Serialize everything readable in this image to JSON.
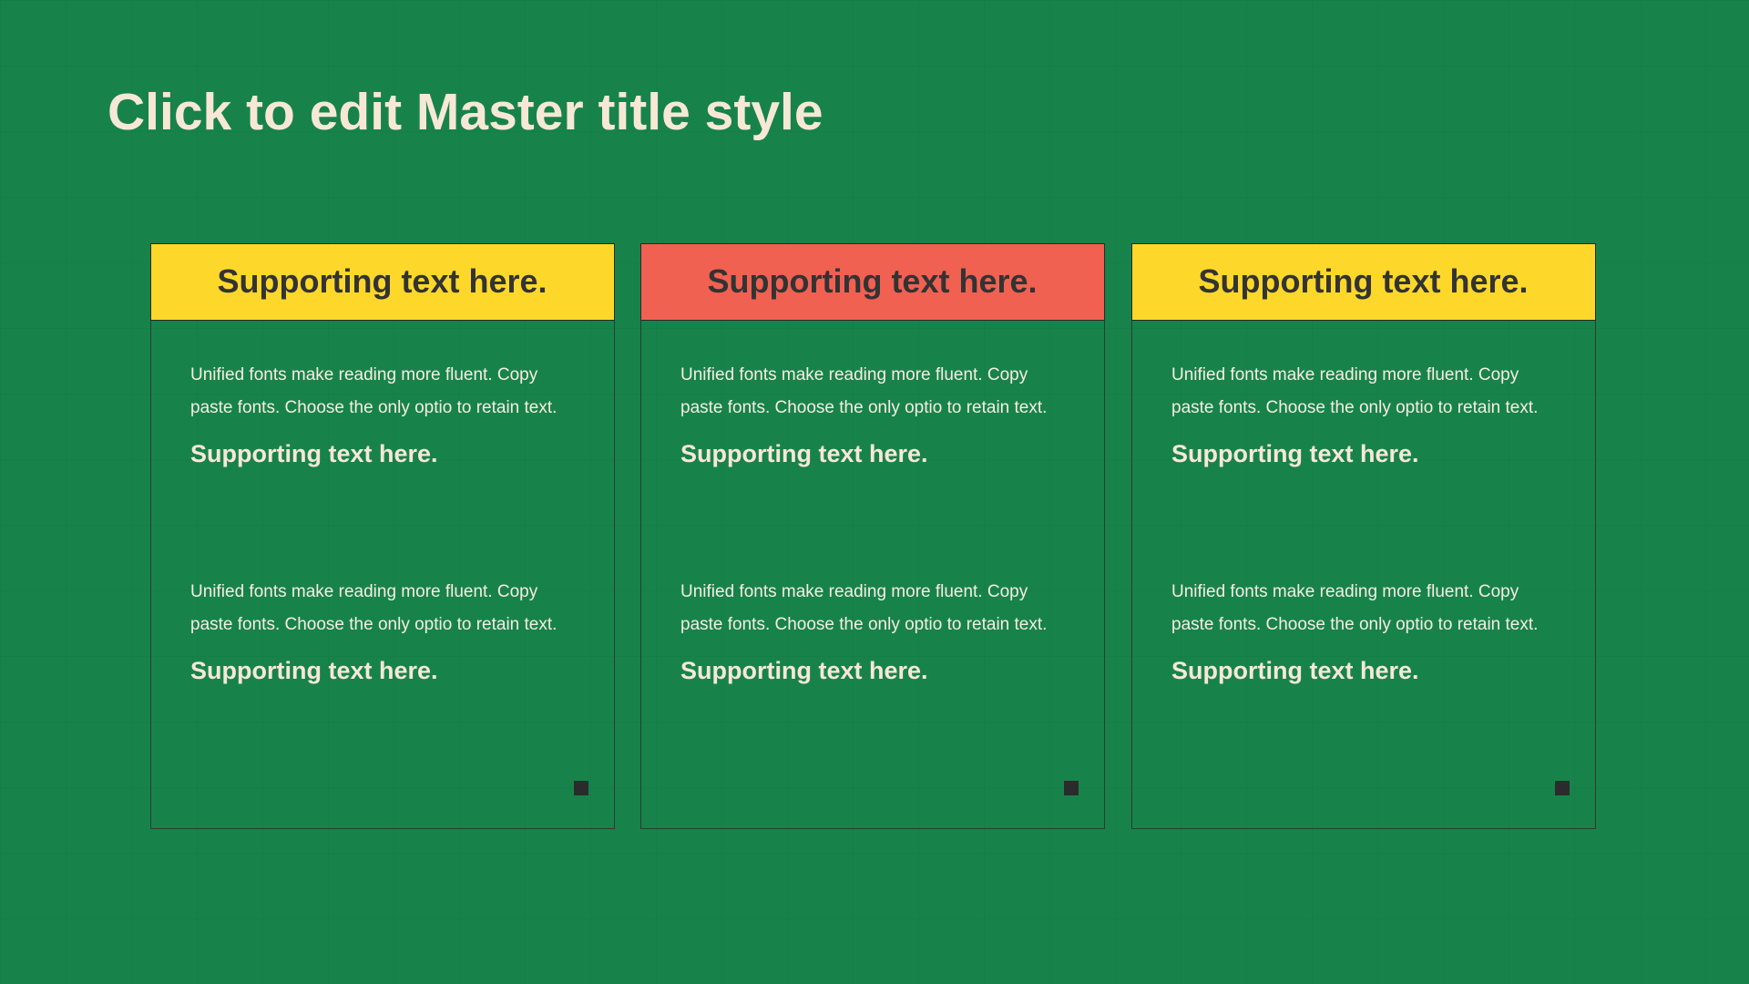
{
  "slide": {
    "title": "Click to edit Master title style"
  },
  "colors": {
    "background": "#17834b",
    "title_text": "#f7e8d6",
    "yellow_header": "#fdd82a",
    "coral_header": "#f06152",
    "header_text": "#333333"
  },
  "cards": [
    {
      "header": "Supporting text here.",
      "header_color": "yellow",
      "blocks": [
        {
          "paragraph": "Unified  fonts make reading more fluent. Copy paste fonts. Choose the only optio to retain text.",
          "heading": "Supporting text here."
        },
        {
          "paragraph": "Unified  fonts make reading more fluent. Copy paste fonts. Choose the only optio to retain text.",
          "heading": "Supporting text here."
        }
      ]
    },
    {
      "header": "Supporting text here.",
      "header_color": "coral",
      "blocks": [
        {
          "paragraph": "Unified  fonts make reading more fluent. Copy paste fonts. Choose the only optio to retain text.",
          "heading": "Supporting text here."
        },
        {
          "paragraph": "Unified  fonts make reading more fluent. Copy paste fonts. Choose the only optio to retain text.",
          "heading": "Supporting text here."
        }
      ]
    },
    {
      "header": "Supporting text here.",
      "header_color": "yellow",
      "blocks": [
        {
          "paragraph": "Unified  fonts make reading more fluent. Copy paste fonts. Choose the only optio to retain text.",
          "heading": "Supporting text here."
        },
        {
          "paragraph": "Unified  fonts make reading more fluent. Copy paste fonts. Choose the only optio to retain text.",
          "heading": "Supporting text here."
        }
      ]
    }
  ]
}
